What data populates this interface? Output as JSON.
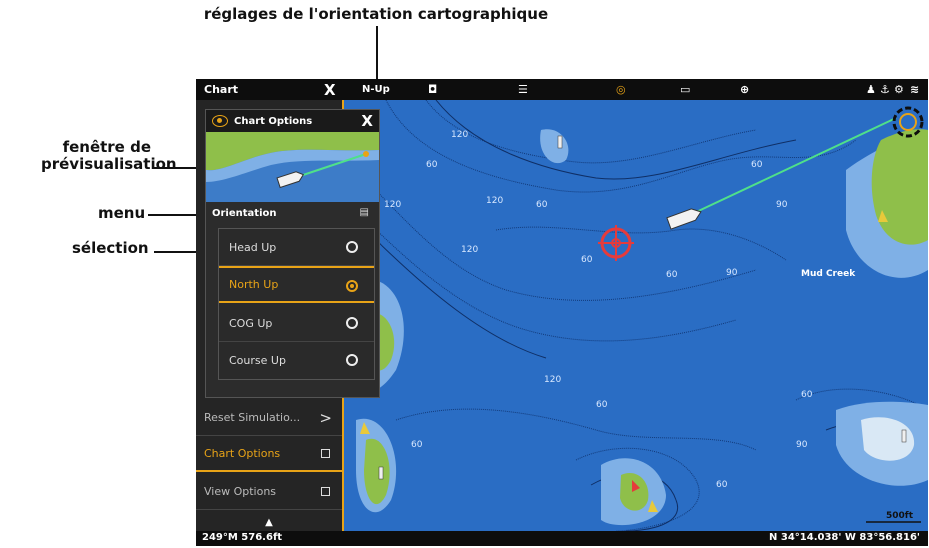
{
  "annotations": {
    "top": "réglages de l'orientation cartographique",
    "preview_line1": "fenêtre de",
    "preview_line2": "prévisualisation",
    "menu": "menu",
    "selection": "sélection"
  },
  "topbar": {
    "title": "Chart",
    "close": "X",
    "orientation_mode": "N-Up",
    "icons": [
      "waypoint-icon",
      "scale-icon",
      "gps-icon",
      "battery-icon",
      "crosshair-icon",
      "person-icon",
      "anchor-icon",
      "gear-icon",
      "signal-icon"
    ]
  },
  "status": {
    "left": "249°M  576.6ft",
    "right": "N 34°14.038' W 83°56.816'"
  },
  "map": {
    "place_name": "Mud Creek",
    "depths": [
      "120",
      "60",
      "60",
      "120",
      "60",
      "60",
      "90",
      "90",
      "60",
      "120",
      "120",
      "60",
      "60",
      "90",
      "60",
      "120",
      "60"
    ],
    "scale_label": "500ft"
  },
  "sidemenu": {
    "items": [
      {
        "label": "Reset Simulatio...",
        "icon": ">"
      },
      {
        "label": "Chart Options",
        "icon": "square"
      },
      {
        "label": "View Options",
        "icon": "square"
      }
    ],
    "chevron": "^"
  },
  "dialog": {
    "title": "Chart Options",
    "close": "X",
    "menu_label": "Orientation",
    "options": [
      {
        "label": "Head Up",
        "selected": false
      },
      {
        "label": "North Up",
        "selected": true
      },
      {
        "label": "COG Up",
        "selected": false
      },
      {
        "label": "Course Up",
        "selected": false
      }
    ]
  },
  "colors": {
    "water": "#2a6dc4",
    "accent": "#e8a317",
    "land": "#8fbf4a"
  }
}
